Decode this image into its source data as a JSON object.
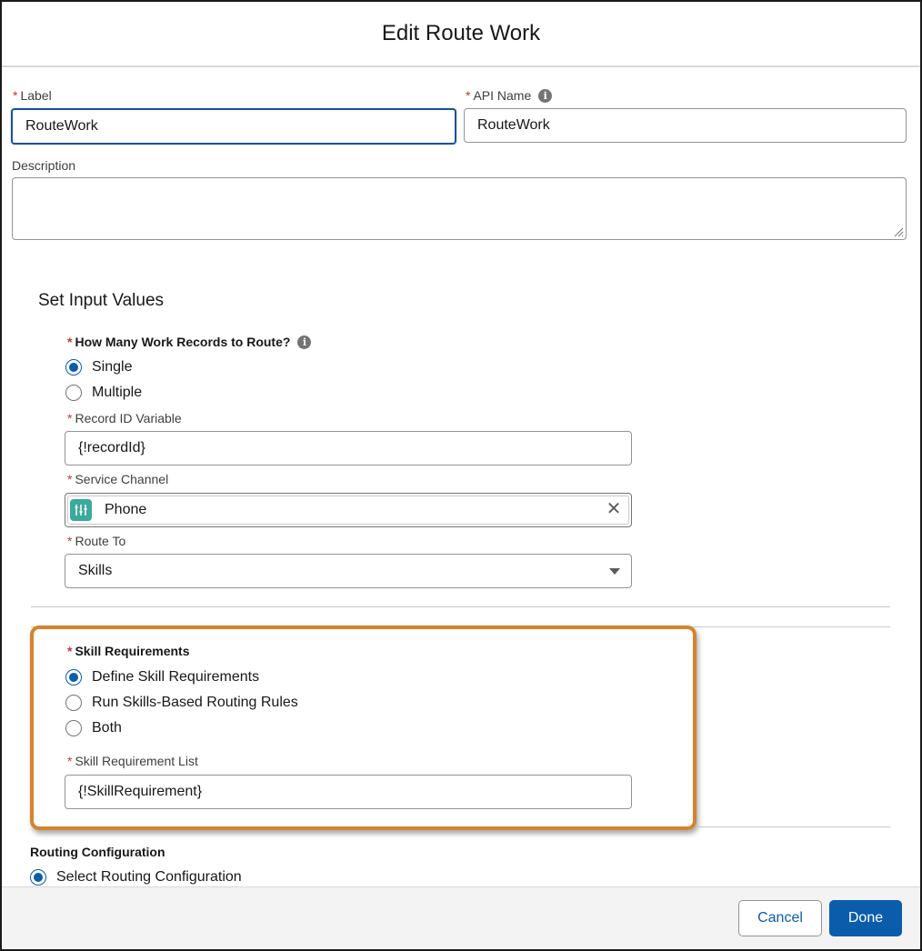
{
  "modal": {
    "title": "Edit Route Work"
  },
  "form": {
    "label": {
      "label": "Label",
      "value": "RouteWork"
    },
    "api_name": {
      "label": "API Name",
      "value": "RouteWork"
    },
    "description": {
      "label": "Description",
      "value": ""
    }
  },
  "inputs": {
    "section_title": "Set Input Values",
    "how_many": {
      "label": "How Many Work Records to Route?",
      "options": [
        "Single",
        "Multiple"
      ],
      "selected": "Single"
    },
    "record_id": {
      "label": "Record ID Variable",
      "value": "{!recordId}"
    },
    "service_channel": {
      "label": "Service Channel",
      "value": "Phone",
      "icon": "service-channel-icon"
    },
    "route_to": {
      "label": "Route To",
      "value": "Skills"
    },
    "skill_requirements": {
      "label": "Skill Requirements",
      "options": [
        "Define Skill Requirements",
        "Run Skills-Based Routing Rules",
        "Both"
      ],
      "selected": "Define Skill Requirements"
    },
    "skill_requirement_list": {
      "label": "Skill Requirement List",
      "value": "{!SkillRequirement}"
    },
    "routing_configuration": {
      "label": "Routing Configuration",
      "options": [
        "Select Routing Configuration"
      ],
      "selected": "Select Routing Configuration"
    }
  },
  "footer": {
    "cancel_label": "Cancel",
    "done_label": "Done"
  },
  "colors": {
    "brand": "#0b5cab",
    "required": "#c23934",
    "highlight": "#d6822e",
    "channel_icon_bg": "#3ba99c"
  }
}
